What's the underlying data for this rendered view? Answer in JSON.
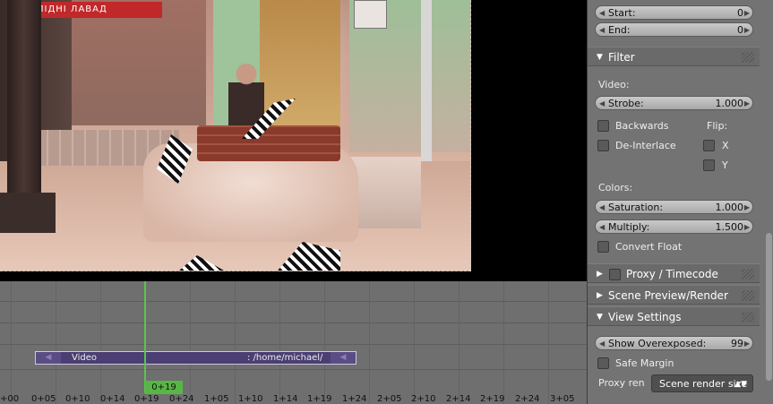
{
  "preview": {
    "banner_text": "ПІДНІ  ЛАВАД"
  },
  "timeline": {
    "strip": {
      "name": "Video",
      "path": ": /home/michael/"
    },
    "current_frame": "0+19",
    "ticks": [
      "+00",
      "0+05",
      "0+10",
      "0+14",
      "0+19",
      "0+24",
      "1+05",
      "1+10",
      "1+14",
      "1+19",
      "1+24",
      "2+05",
      "2+10",
      "2+14",
      "2+19",
      "2+24",
      "3+05"
    ]
  },
  "sidebar": {
    "start": {
      "label": "Start:",
      "value": "0"
    },
    "end": {
      "label": "End:",
      "value": "0"
    },
    "filter_panel": {
      "title": "Filter",
      "video_label": "Video:",
      "strobe": {
        "label": "Strobe:",
        "value": "1.000"
      },
      "backwards": "Backwards",
      "flip_label": "Flip:",
      "deinterlace": "De-Interlace",
      "flip_x": "X",
      "flip_y": "Y",
      "colors_label": "Colors:",
      "saturation": {
        "label": "Saturation:",
        "value": "1.000"
      },
      "multiply": {
        "label": "Multiply:",
        "value": "1.500"
      },
      "convert_float": "Convert Float"
    },
    "proxy_panel": {
      "title": "Proxy / Timecode"
    },
    "scene_preview_panel": {
      "title": "Scene Preview/Render"
    },
    "view_settings_panel": {
      "title": "View Settings",
      "show_overexposed": {
        "label": "Show Overexposed:",
        "value": "99"
      },
      "safe_margin": "Safe Margin",
      "proxy_render_label": "Proxy ren",
      "proxy_render_value": "Scene render size"
    }
  },
  "colors": {
    "playhead": "#5ac44c",
    "strip": "#4b3e72"
  }
}
